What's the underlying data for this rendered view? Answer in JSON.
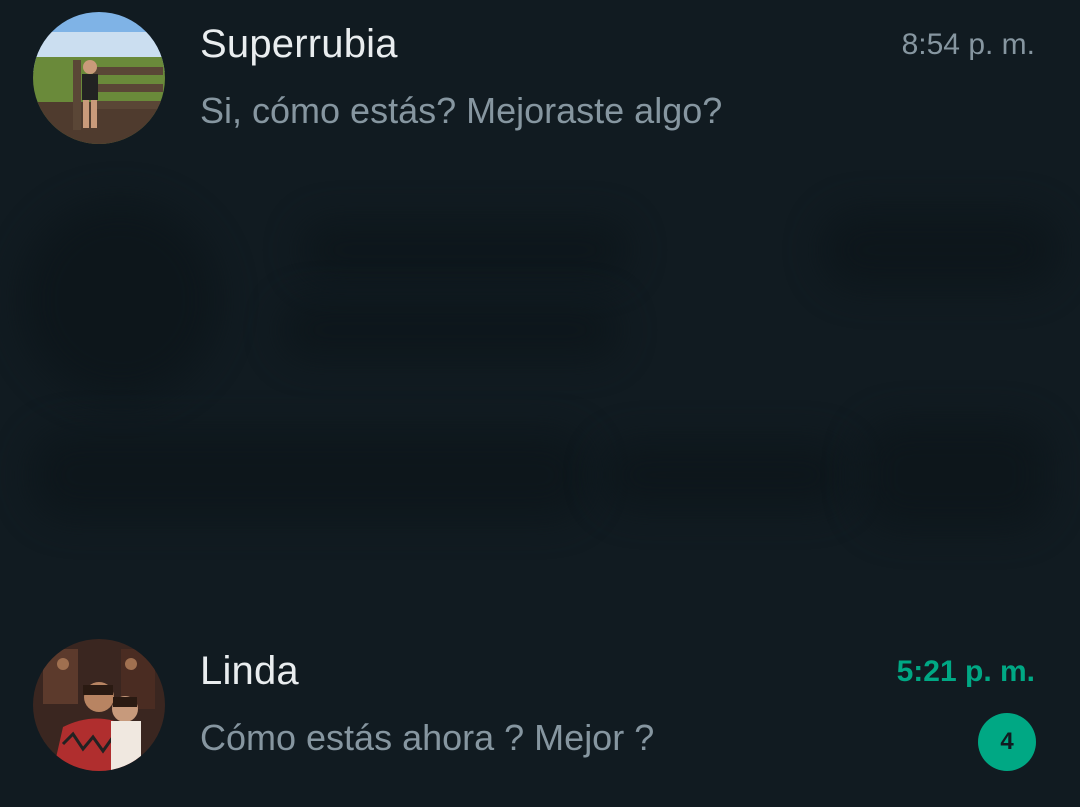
{
  "chats": [
    {
      "name": "Superrubia",
      "time": "8:54 p. m.",
      "preview": "Si, cómo estás? Mejoraste algo?"
    },
    {
      "name": "Linda",
      "time": "5:21 p. m.",
      "preview": "Cómo estás ahora ? Mejor ?",
      "unread_count": "4"
    }
  ],
  "colors": {
    "background": "#111b21",
    "accent": "#00a884",
    "primary_text": "#e9edef",
    "secondary_text": "#8696a0"
  }
}
